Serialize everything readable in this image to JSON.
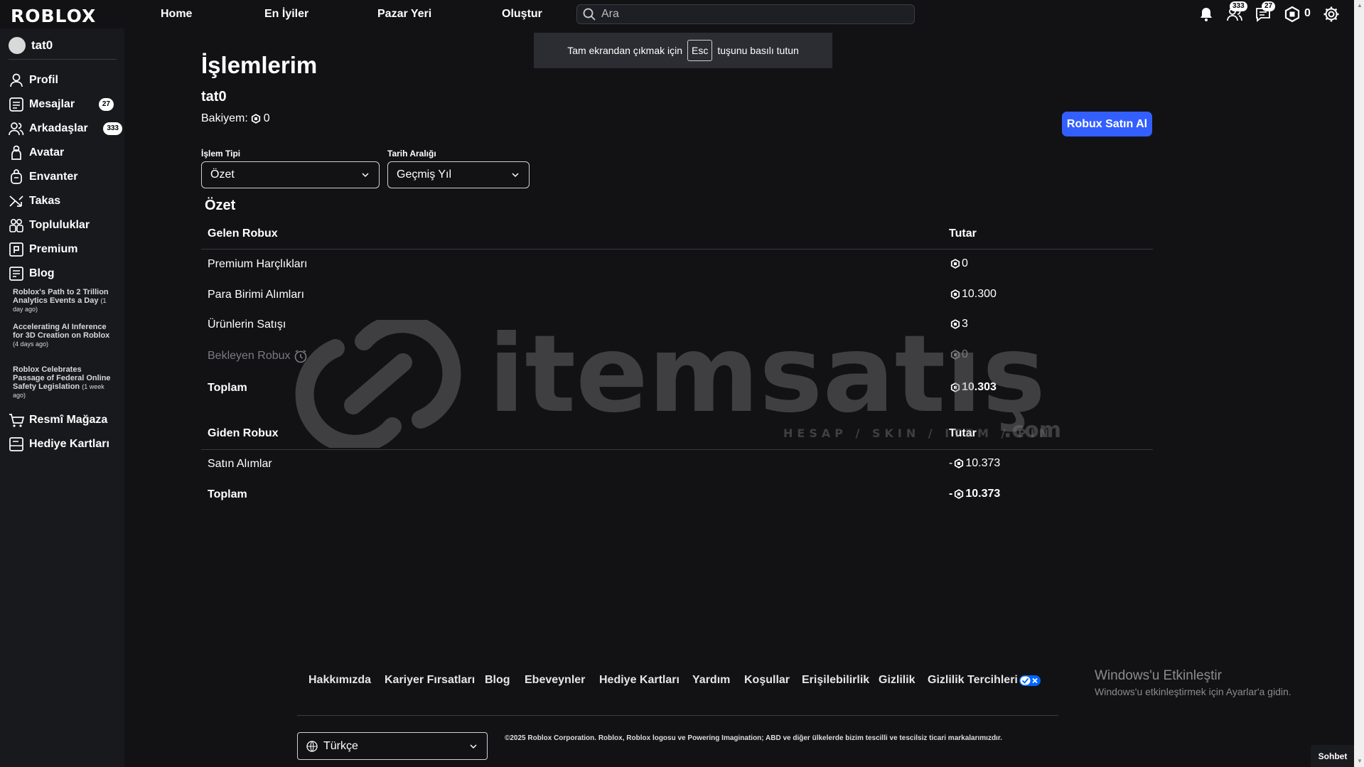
{
  "topbar": {
    "logo": "ROBLOX",
    "nav": [
      "Home",
      "En İyiler",
      "Pazar Yeri",
      "Oluştur"
    ],
    "search_placeholder": "Ara",
    "friends_badge": "333",
    "messages_badge": "27",
    "robux_count": "0"
  },
  "toast": {
    "before": "Tam ekrandan çıkmak için",
    "key": "Esc",
    "after": "tuşunu basılı tutun"
  },
  "sidebar": {
    "username": "tat0",
    "items": [
      {
        "label": "Profil",
        "icon": "profile-icon"
      },
      {
        "label": "Mesajlar",
        "icon": "messages-icon",
        "badge": "27"
      },
      {
        "label": "Arkadaşlar",
        "icon": "friends-icon",
        "badge": "333"
      },
      {
        "label": "Avatar",
        "icon": "avatar-icon"
      },
      {
        "label": "Envanter",
        "icon": "inventory-icon"
      },
      {
        "label": "Takas",
        "icon": "trade-icon"
      },
      {
        "label": "Topluluklar",
        "icon": "communities-icon"
      },
      {
        "label": "Premium",
        "icon": "premium-icon"
      },
      {
        "label": "Blog",
        "icon": "blog-icon"
      }
    ],
    "blog_posts": [
      {
        "title": "Roblox's Path to 2 Trillion Analytics Events a Day",
        "ago": "(1 day ago)"
      },
      {
        "title": "Accelerating AI Inference for 3D Creation on Roblox",
        "ago": "(4 days ago)"
      },
      {
        "title": "Roblox Celebrates Passage of Federal Online Safety Legislation",
        "ago": "(1 week ago)"
      }
    ],
    "bottom_items": [
      {
        "label": "Resmî Mağaza",
        "icon": "shop-icon"
      },
      {
        "label": "Hediye Kartları",
        "icon": "gift-card-icon"
      }
    ]
  },
  "main": {
    "title": "İşlemlerim",
    "username": "tat0",
    "balance_label": "Bakiyem:",
    "balance_value": "0",
    "buy_button": "Robux Satın Al",
    "transaction_type_label": "İşlem Tipi",
    "transaction_type_value": "Özet",
    "date_range_label": "Tarih Aralığı",
    "date_range_value": "Geçmiş Yıl",
    "summary_heading": "Özet",
    "incoming": {
      "header": "Gelen Robux",
      "amount_header": "Tutar",
      "rows": [
        {
          "label": "Premium Harçlıkları",
          "amount": "0"
        },
        {
          "label": "Para Birimi Alımları",
          "amount": "10.300"
        },
        {
          "label": "Ürünlerin Satışı",
          "amount": "3"
        },
        {
          "label": "Bekleyen Robux",
          "amount": "0"
        }
      ],
      "total_label": "Toplam",
      "total_amount": "10.303"
    },
    "outgoing": {
      "header": "Giden Robux",
      "amount_header": "Tutar",
      "rows": [
        {
          "label": "Satın Alımlar",
          "amount": "-",
          "value": "10.373"
        }
      ],
      "total_label": "Toplam",
      "total_sign": "-",
      "total_amount": "10.373"
    }
  },
  "watermark": {
    "brand": "itemsatış",
    "tagline": "HESAP / SKIN / ITEM / PIN",
    "domain": ".com"
  },
  "footer": {
    "links": [
      "Hakkımızda",
      "Kariyer Fırsatları",
      "Blog",
      "Ebeveynler",
      "Hediye Kartları",
      "Yardım",
      "Koşullar",
      "Erişilebilirlik",
      "Gizlilik",
      "Gizlilik Tercihleri"
    ],
    "language": "Türkçe",
    "copyright": "©2025 Roblox Corporation. Roblox, Roblox logosu ve Powering Imagination; ABD ve diğer ülkelerde bizim tescilli ve tescilsiz ticari markalarımızdır."
  },
  "windows": {
    "title": "Windows'u Etkinleştir",
    "subtitle": "Windows'u etkinleştirmek için Ayarlar'a gidin."
  },
  "chat": {
    "label": "Sohbet"
  },
  "colors": {
    "accent": "#335fff",
    "background": "#121215",
    "sidebar": "#18191d"
  }
}
